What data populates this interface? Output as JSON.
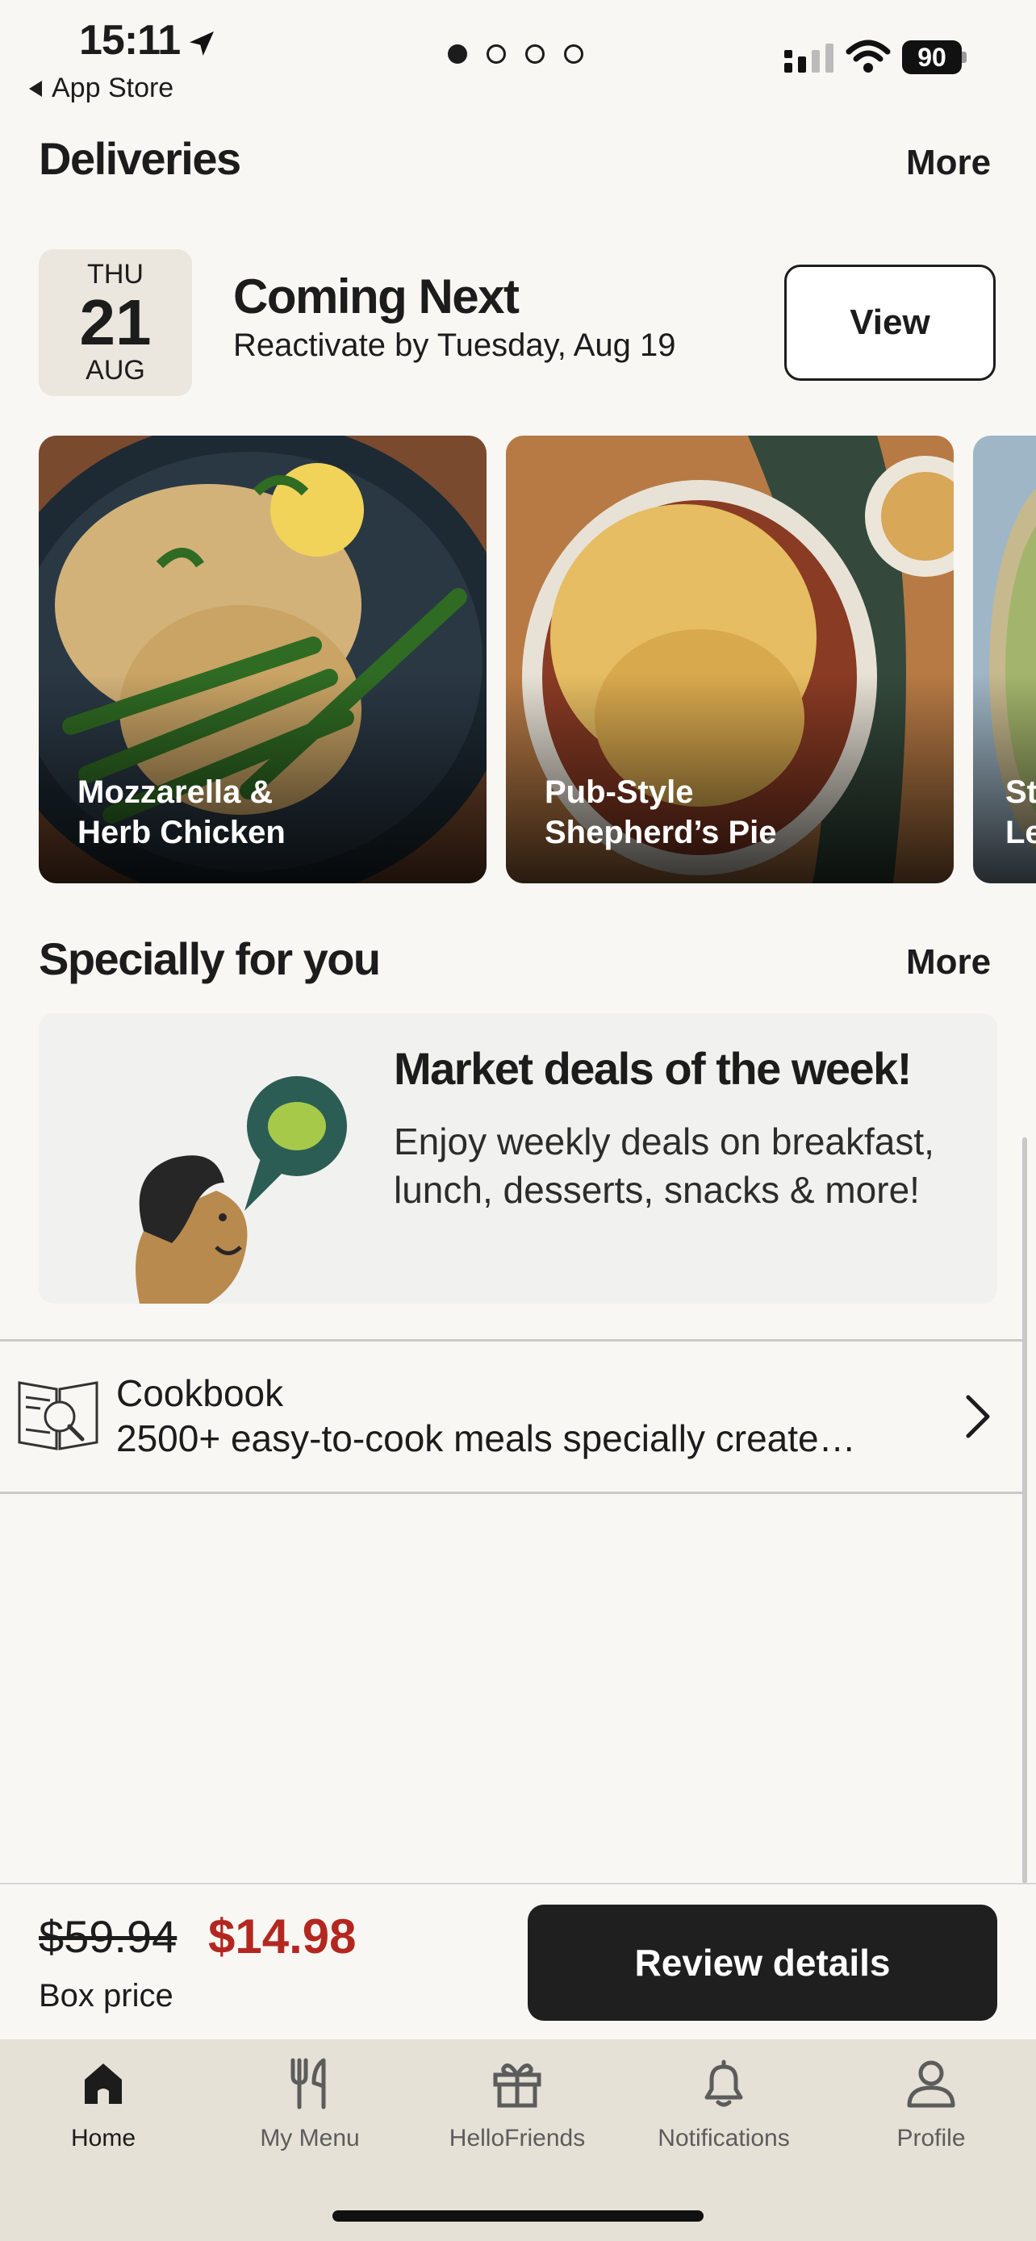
{
  "status_bar": {
    "time": "15:11",
    "back_label": "App Store",
    "battery": "90"
  },
  "deliveries": {
    "title": "Deliveries",
    "more": "More",
    "date": {
      "weekday": "THU",
      "day": "21",
      "month": "AUG"
    },
    "coming_title": "Coming Next",
    "coming_sub": "Reactivate by Tuesday, Aug 19",
    "view_label": "View",
    "meals": [
      {
        "name": "Mozzarella &\nHerb Chicken"
      },
      {
        "name": "Pub-Style\nShepherd’s Pie"
      },
      {
        "name": "St\nLe"
      }
    ]
  },
  "special": {
    "title": "Specially for you",
    "more": "More",
    "promo_title": "Market deals of the week!",
    "promo_body": "Enjoy weekly deals on breakfast, lunch, desserts, snacks & more!"
  },
  "cookbook": {
    "title": "Cookbook",
    "description": "2500+ easy-to-cook meals specially create…"
  },
  "purchase": {
    "old_price": "$59.94",
    "new_price": "$14.98",
    "price_label": "Box price",
    "review_label": "Review details"
  },
  "tabs": [
    {
      "label": "Home",
      "icon": "home-icon"
    },
    {
      "label": "My Menu",
      "icon": "fork-knife-icon"
    },
    {
      "label": "HelloFriends",
      "icon": "gift-icon"
    },
    {
      "label": "Notifications",
      "icon": "bell-icon"
    },
    {
      "label": "Profile",
      "icon": "person-icon"
    }
  ],
  "colors": {
    "background": "#f8f7f3",
    "sale_price": "#b32720",
    "button_dark": "#1f1f1f",
    "tab_bar": "#e6e1d6"
  }
}
